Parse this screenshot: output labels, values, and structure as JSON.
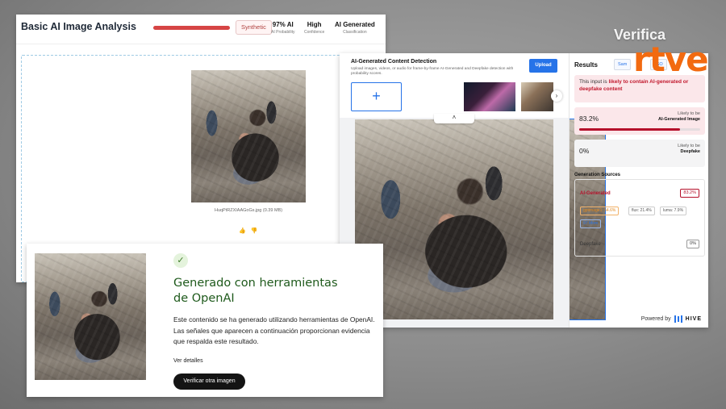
{
  "analysis_panel": {
    "title": "Basic AI Image Analysis",
    "verdict": "Synthetic",
    "stats": [
      {
        "value": "97% AI",
        "label": "AI Probability"
      },
      {
        "value": "High",
        "label": "Confidence"
      },
      {
        "value": "AI Generated",
        "label": "Classification"
      }
    ],
    "filename": "HuqPtRZXIAAGoGs.jpg (0.39 MB)",
    "feedback_icons": [
      "thumbs-up-icon",
      "thumbs-down-icon"
    ]
  },
  "hive_panel": {
    "title": "AI-Generated Content Detection",
    "subtitle": "Upload images, videos, or audio for frame-by-frame AI-Generated and Deepfake detection with probability scores.",
    "upload_label": "Upload",
    "add_label": "+",
    "results_title": "Results",
    "chips": [
      "Sam",
      "JSO"
    ],
    "verdict_prefix": "This input is ",
    "verdict_strong": "likely to contain AI-generated or deepfake content",
    "ai_score": {
      "percent_text": "83.2%",
      "value": 0.832,
      "label_top": "Likely to be",
      "label_bottom": "AI-Generated Image"
    },
    "deepfake_score": {
      "percent_text": "0%",
      "value": 0.0,
      "label_top": "Likely to be",
      "label_bottom": "Deepfake"
    },
    "generation_sources_title": "Generation Sources",
    "ai_generated_label": "AI-Generated",
    "ai_generated_value": "83.2%",
    "sources": [
      {
        "text": "gptimage1: 54.6%",
        "highlight": true
      },
      {
        "text": "flux: 21.4%",
        "highlight": false
      },
      {
        "text": "luma: 7.9%",
        "highlight": false
      }
    ],
    "more_label": "97 More",
    "deepfake_label": "Deepfake",
    "deepfake_value": "0%",
    "powered_by": "Powered by",
    "powered_brand": "HIVE"
  },
  "openai_panel": {
    "check_symbol": "✓",
    "heading_line1": "Generado con herramientas",
    "heading_line2": "de OpenAI",
    "body": "Este contenido se ha generado utilizando herramientas de OpenAI. Las señales que aparecen a continuación proporcionan evidencia que respalda este resultado.",
    "details_link": "Ver detalles",
    "verify_button": "Verificar otra imagen"
  },
  "branding": {
    "verifica": "Verifica",
    "rtve": "rtve"
  },
  "colors": {
    "ai_red": "#b5102a",
    "hive_blue": "#2673e8",
    "openai_green": "#1f5a1c",
    "rtve_orange": "#f26a10"
  }
}
